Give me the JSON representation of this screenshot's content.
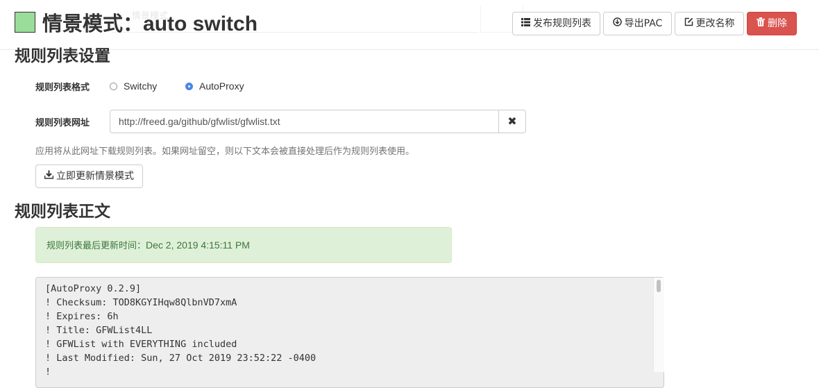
{
  "header": {
    "title_prefix": "情景模式：",
    "profile_name": "auto switch",
    "swatch_color": "#99dd99",
    "ghost_text": "情景模式",
    "buttons": {
      "publish_label": "发布规则列表",
      "export_label": "导出PAC",
      "rename_label": "更改名称",
      "delete_label": "删除"
    }
  },
  "settings": {
    "section_title": "规则列表设置",
    "format_label": "规则列表格式",
    "format_options": [
      {
        "label": "Switchy",
        "selected": false
      },
      {
        "label": "AutoProxy",
        "selected": true
      }
    ],
    "url_label": "规则列表网址",
    "url_value": "http://freed.ga/github/gfwlist/gfwlist.txt",
    "help_text": "应用将从此网址下载规则列表。如果网址留空，则以下文本会被直接处理后作为规则列表使用。",
    "update_button_label": "立即更新情景模式"
  },
  "content": {
    "section_title": "规则列表正文",
    "last_updated_prefix": "规则列表最后更新时间：",
    "last_updated_time": "Dec 2, 2019 4:15:11 PM",
    "rules_lines": [
      "[AutoProxy 0.2.9]",
      "! Checksum: TOD8KGYIHqw8QlbnVD7xmA",
      "! Expires: 6h",
      "! Title: GFWList4LL",
      "! GFWList with EVERYTHING included",
      "! Last Modified: Sun, 27 Oct 2019 23:52:22 -0400",
      "!"
    ]
  },
  "colors": {
    "danger": "#d9534f",
    "success_bg": "#dff0d8",
    "success_text": "#3c763d",
    "radio_accent": "#4a86e8"
  }
}
